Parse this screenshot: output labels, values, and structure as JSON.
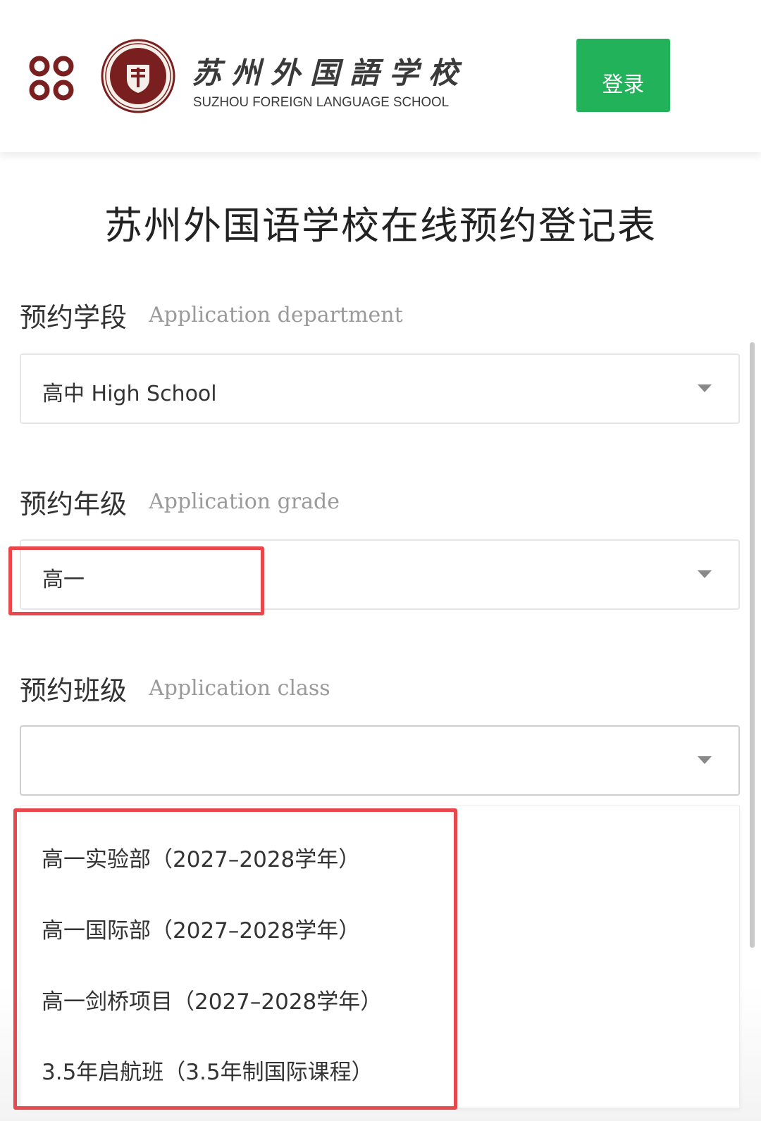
{
  "header": {
    "menu_icon": "menu-grid-icon",
    "emblem_icon": "school-emblem-icon",
    "school_name_cn": "苏州外国語学校",
    "school_name_en": "SUZHOU FOREIGN LANGUAGE SCHOOL",
    "login_label": "登录",
    "login_color": "#22b35a"
  },
  "page": {
    "title": "苏州外国语学校在线预约登记表"
  },
  "fields": {
    "department": {
      "label_cn": "预约学段",
      "label_en": "Application department",
      "value": "高中 High School"
    },
    "grade": {
      "label_cn": "预约年级",
      "label_en": "Application grade",
      "value": "高一"
    },
    "class": {
      "label_cn": "预约班级",
      "label_en": "Application class",
      "value": ""
    }
  },
  "class_options": [
    "高一实验部（2027–2028学年）",
    "高一国际部（2027–2028学年）",
    "高一剑桥项目（2027–2028学年）",
    "3.5年启航班（3.5年制国际课程）"
  ],
  "highlight_color": "#e8474b"
}
